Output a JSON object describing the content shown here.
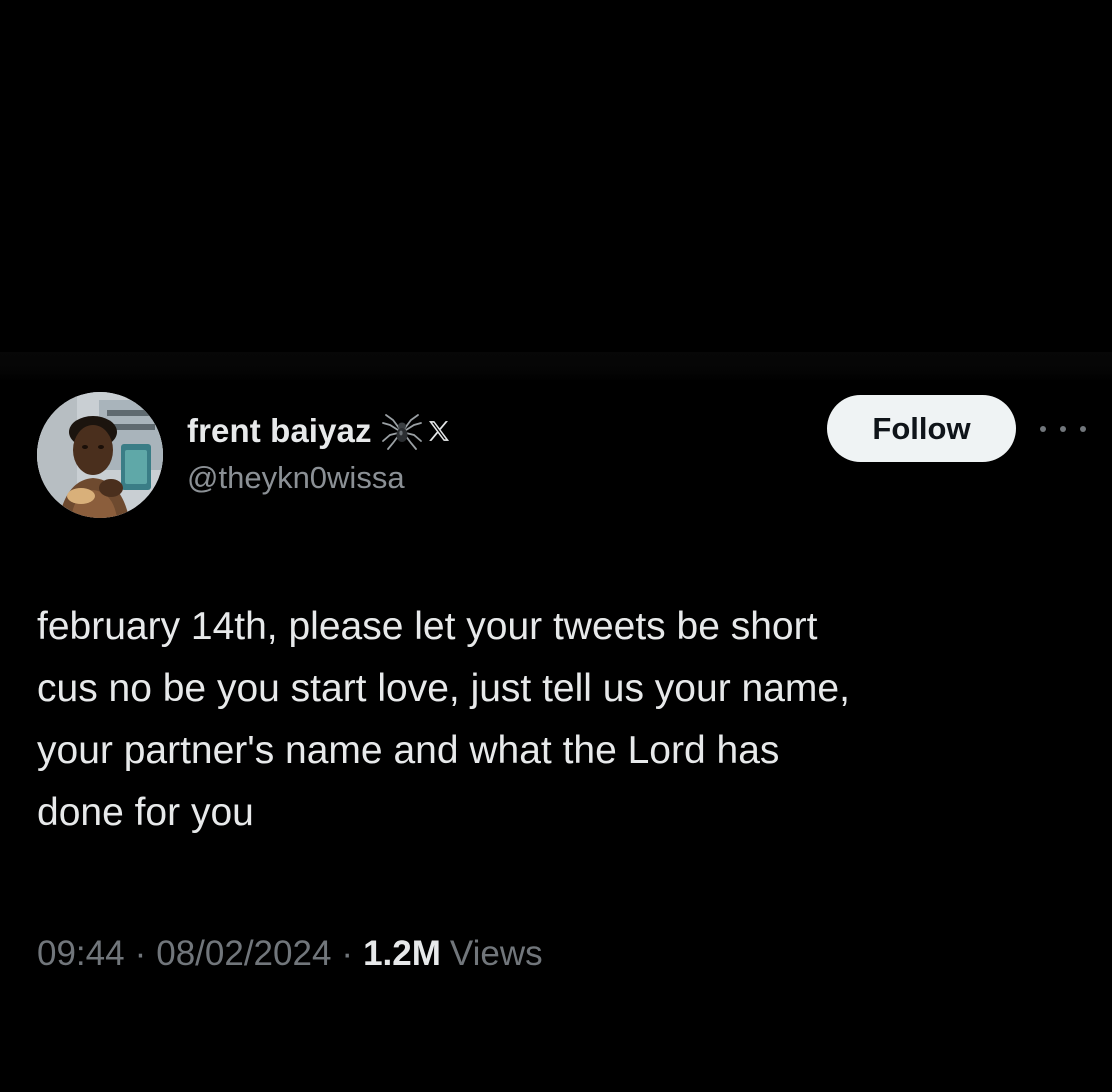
{
  "post": {
    "author": {
      "display_name": "frent baiyaz",
      "handle": "@theykn0wissa",
      "badge_icons": [
        "spider-icon",
        "x-logo-icon"
      ]
    },
    "follow_label": "Follow",
    "more_icon": "ellipsis-icon",
    "text_lines": [
      "february 14th, please let your tweets be short",
      "cus no be you start love, just tell us your name,",
      "your partner's name and what the Lord has",
      "done for you"
    ],
    "meta": {
      "time": "09:44",
      "date": "08/02/2024",
      "separator": "·",
      "views_count": "1.2M",
      "views_label": "Views"
    }
  },
  "colors": {
    "background": "#000000",
    "primary_text": "#e7e9ea",
    "secondary_text": "#71767b",
    "follow_button_bg": "#eff3f4",
    "follow_button_text": "#0f1419"
  }
}
